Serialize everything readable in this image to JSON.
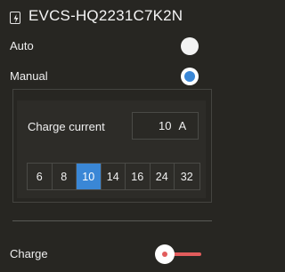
{
  "header": {
    "title": "EVCS-HQ2231C7K2N",
    "icon": "ev-charger-icon"
  },
  "modes": {
    "auto_label": "Auto",
    "manual_label": "Manual",
    "selected": "Manual"
  },
  "charge_current": {
    "label": "Charge current",
    "value": "10",
    "unit": "A",
    "options": [
      "6",
      "8",
      "10",
      "14",
      "16",
      "24",
      "32"
    ],
    "selected": "10"
  },
  "charge": {
    "label": "Charge",
    "enabled": false
  },
  "colors": {
    "background": "#272622",
    "accent": "#3a87d6",
    "toggle_off": "#e25c5c"
  }
}
